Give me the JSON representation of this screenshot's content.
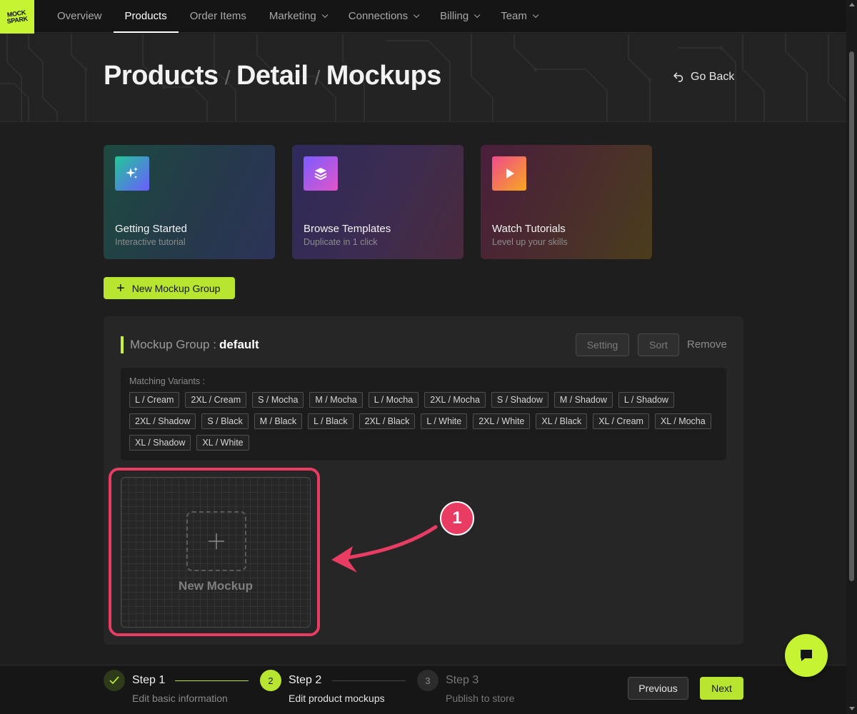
{
  "brand": {
    "logo_text": "MOCK SPARK",
    "accent": "#c6f432",
    "highlight": "#e83c63"
  },
  "nav": {
    "items": [
      {
        "label": "Overview",
        "dropdown": false,
        "active": false
      },
      {
        "label": "Products",
        "dropdown": false,
        "active": true
      },
      {
        "label": "Order Items",
        "dropdown": false,
        "active": false
      },
      {
        "label": "Marketing",
        "dropdown": true,
        "active": false
      },
      {
        "label": "Connections",
        "dropdown": true,
        "active": false
      },
      {
        "label": "Billing",
        "dropdown": true,
        "active": false
      },
      {
        "label": "Team",
        "dropdown": true,
        "active": false
      }
    ]
  },
  "header": {
    "breadcrumb": [
      "Products",
      "Detail",
      "Mockups"
    ],
    "go_back": "Go Back"
  },
  "cards": [
    {
      "title": "Getting Started",
      "subtitle": "Interactive tutorial",
      "icon": "sparkles-icon"
    },
    {
      "title": "Browse Templates",
      "subtitle": "Duplicate in 1 click",
      "icon": "layers-icon"
    },
    {
      "title": "Watch Tutorials",
      "subtitle": "Level up your skills",
      "icon": "play-icon"
    }
  ],
  "new_group_button": "New Mockup Group",
  "group": {
    "label": "Mockup Group :",
    "name": "default",
    "setting": "Setting",
    "sort": "Sort",
    "remove": "Remove",
    "variants_label": "Matching Variants :",
    "variants": [
      "L / Cream",
      "2XL / Cream",
      "S / Mocha",
      "M / Mocha",
      "L / Mocha",
      "2XL / Mocha",
      "S / Shadow",
      "M / Shadow",
      "L / Shadow",
      "2XL / Shadow",
      "S / Black",
      "M / Black",
      "L / Black",
      "2XL / Black",
      "L / White",
      "2XL / White",
      "XL / Black",
      "XL / Cream",
      "XL / Mocha",
      "XL / Shadow",
      "XL / White"
    ],
    "new_mockup": "New Mockup"
  },
  "annotation": {
    "number": "1"
  },
  "stepper": {
    "steps": [
      {
        "title": "Step 1",
        "subtitle": "Edit basic information",
        "state": "done",
        "number": "1"
      },
      {
        "title": "Step 2",
        "subtitle": "Edit product mockups",
        "state": "current",
        "number": "2"
      },
      {
        "title": "Step 3",
        "subtitle": "Publish to store",
        "state": "pending",
        "number": "3"
      }
    ],
    "previous": "Previous",
    "next": "Next"
  }
}
